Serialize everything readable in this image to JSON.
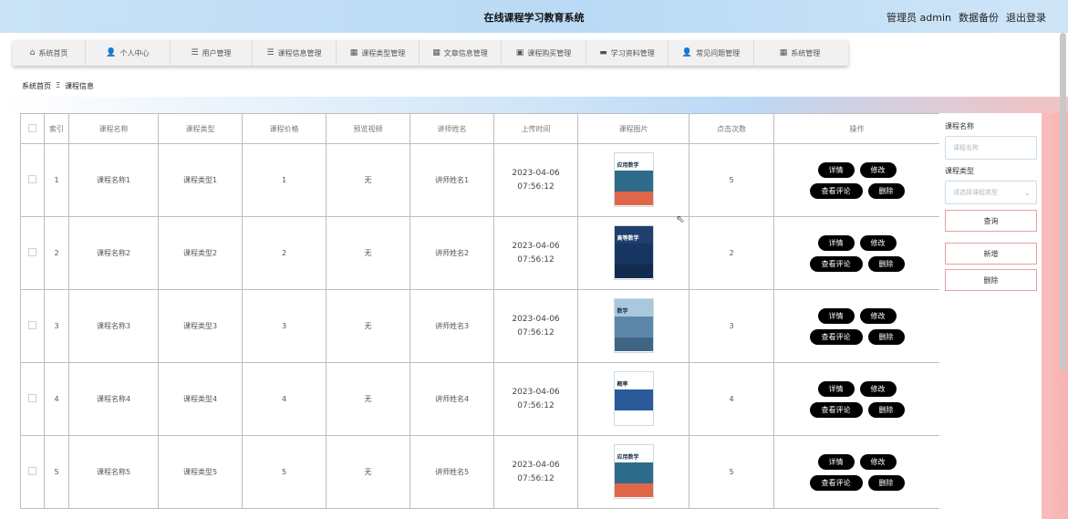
{
  "header": {
    "title": "在线课程学习教育系统",
    "user_label": "管理员 admin",
    "backup_label": "数据备份",
    "logout_label": "退出登录"
  },
  "nav": {
    "items": [
      {
        "label": "系统首页",
        "icon": "⌂",
        "icon_name": "home-icon"
      },
      {
        "label": "个人中心",
        "icon": "👤",
        "icon_name": "user-icon"
      },
      {
        "label": "用户管理",
        "icon": "☰",
        "icon_name": "list-icon"
      },
      {
        "label": "课程信息管理",
        "icon": "☰",
        "icon_name": "list-icon"
      },
      {
        "label": "课程类型管理",
        "icon": "▦",
        "icon_name": "grid-icon"
      },
      {
        "label": "文章信息管理",
        "icon": "▦",
        "icon_name": "table-icon"
      },
      {
        "label": "课程购买管理",
        "icon": "▣",
        "icon_name": "box-icon"
      },
      {
        "label": "学习资料管理",
        "icon": "▬",
        "icon_name": "folder-icon"
      },
      {
        "label": "常见问题管理",
        "icon": "👤",
        "icon_name": "user-icon"
      },
      {
        "label": "系统管理",
        "icon": "▦",
        "icon_name": "grid-icon"
      }
    ]
  },
  "breadcrumb": {
    "home": "系统首页",
    "separator": "Ξ",
    "current": "课程信息"
  },
  "table": {
    "headers": [
      "",
      "索引",
      "课程名称",
      "课程类型",
      "课程价格",
      "预览视频",
      "讲师姓名",
      "上传时间",
      "课程图片",
      "点击次数",
      "操作"
    ],
    "rows": [
      {
        "index": "1",
        "name": "课程名称1",
        "type": "课程类型1",
        "price": "1",
        "video": "无",
        "teacher": "讲师姓名1",
        "time": "2023-04-06 07:56:12",
        "clicks": "5",
        "cover": {
          "title": "应用数学",
          "top": "#ffffff",
          "mid": "#2f6b8a",
          "bot": "#e0664a"
        }
      },
      {
        "index": "2",
        "name": "课程名称2",
        "type": "课程类型2",
        "price": "2",
        "video": "无",
        "teacher": "讲师姓名2",
        "time": "2023-04-06 07:56:12",
        "clicks": "2",
        "cover": {
          "title": "高等数学",
          "top": "#1f3f6e",
          "mid": "#173561",
          "bot": "#122a4d"
        }
      },
      {
        "index": "3",
        "name": "课程名称3",
        "type": "课程类型3",
        "price": "3",
        "video": "无",
        "teacher": "讲师姓名3",
        "time": "2023-04-06 07:56:12",
        "clicks": "3",
        "cover": {
          "title": "数学",
          "top": "#a8c8de",
          "mid": "#5d86a8",
          "bot": "#3f6585"
        }
      },
      {
        "index": "4",
        "name": "课程名称4",
        "type": "课程类型4",
        "price": "4",
        "video": "无",
        "teacher": "讲师姓名4",
        "time": "2023-04-06 07:56:12",
        "clicks": "4",
        "cover": {
          "title": "概率",
          "top": "#ffffff",
          "mid": "#2a5a9a",
          "bot": "#ffffff"
        }
      },
      {
        "index": "5",
        "name": "课程名称5",
        "type": "课程类型5",
        "price": "5",
        "video": "无",
        "teacher": "讲师姓名5",
        "time": "2023-04-06 07:56:12",
        "clicks": "5",
        "cover": {
          "title": "应用数学",
          "top": "#ffffff",
          "mid": "#2f6b8a",
          "bot": "#e0664a"
        }
      }
    ],
    "actions": {
      "detail": "详情",
      "edit": "修改",
      "comments": "查看评论",
      "delete": "删除"
    }
  },
  "side": {
    "name_label": "课程名称",
    "name_placeholder": "课程名称",
    "type_label": "课程类型",
    "type_placeholder": "请选择课程类型",
    "query_button": "查询",
    "add_button": "新增",
    "delete_button": "删除"
  }
}
